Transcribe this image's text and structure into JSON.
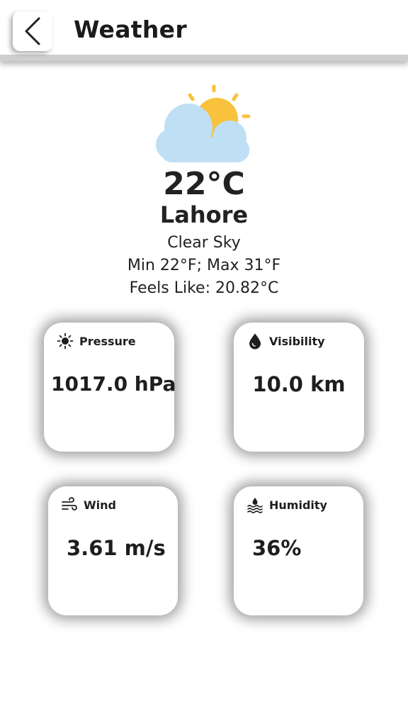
{
  "header": {
    "title": "Weather"
  },
  "current": {
    "icon": "partly-cloudy-icon",
    "temperature": "22°C",
    "city": "Lahore",
    "description": "Clear Sky",
    "min_max": "Min 22°F; Max 31°F",
    "feels_like": "Feels Like: 20.82°C"
  },
  "cards": {
    "pressure": {
      "label": "Pressure",
      "value": "1017.0 hPa",
      "icon": "sun-icon"
    },
    "visibility": {
      "label": "Visibility",
      "value": "10.0 km",
      "icon": "drop-icon"
    },
    "wind": {
      "label": "Wind",
      "value": "3.61 m/s",
      "icon": "wind-icon"
    },
    "humidity": {
      "label": "Humidity",
      "value": "36%",
      "icon": "humidity-icon"
    }
  },
  "colors": {
    "cloud": "#bfdff5",
    "sun": "#f9c23c",
    "text": "#1f1f1f"
  }
}
